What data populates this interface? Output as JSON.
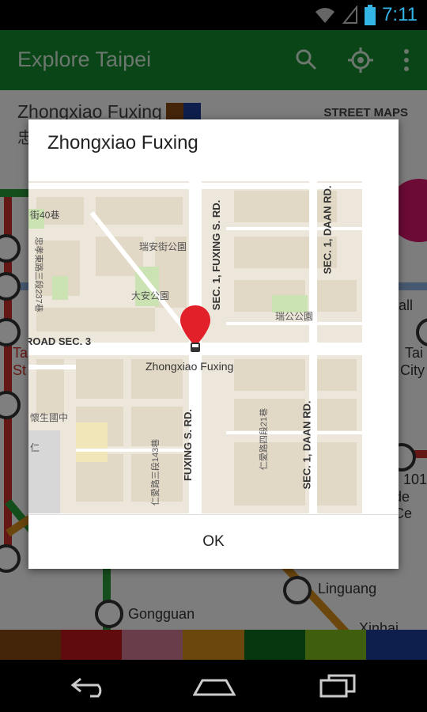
{
  "status": {
    "time": "7:11"
  },
  "toolbar": {
    "title": "Explore Taipei"
  },
  "background": {
    "station_title": "Zhongxiao Fuxing",
    "station_subtitle": "忠",
    "street_maps": "STREET MAPS",
    "left_labels": [
      "Ta",
      "St"
    ],
    "right_labels": [
      "Tai",
      "City",
      "all",
      "101",
      "de Ce"
    ],
    "stations": [
      "Linguang",
      "Gongguan",
      "Xinhai"
    ]
  },
  "dialog": {
    "title": "Zhongxiao Fuxing",
    "ok": "OK",
    "map": {
      "marker_label": "Zhongxiao Fuxing",
      "roads": [
        "FUXING S. RD.",
        "SEC. 1, FUXING S. RD.",
        "SEC. 1, DAAN RD.",
        "ROAD SEC. 3"
      ],
      "roads_bottom": [
        "FUXING S. RD.",
        "SEC. 1, DAAN RD."
      ],
      "poi": [
        "街40巷",
        "瑞安街公園",
        "大安公園",
        "瑞公公園",
        "懷生國中",
        "仁愛路三段143巷",
        "仁愛路四段21巷",
        "忠孝東路三段237巷",
        "仁"
      ]
    }
  },
  "colors": {
    "appbar": "#128a2e",
    "palette": [
      "#8b4a12",
      "#c0161d",
      "#d27b94",
      "#d68f1d",
      "#0c6f1e",
      "#7fbf1d",
      "#1d3f9a"
    ]
  }
}
